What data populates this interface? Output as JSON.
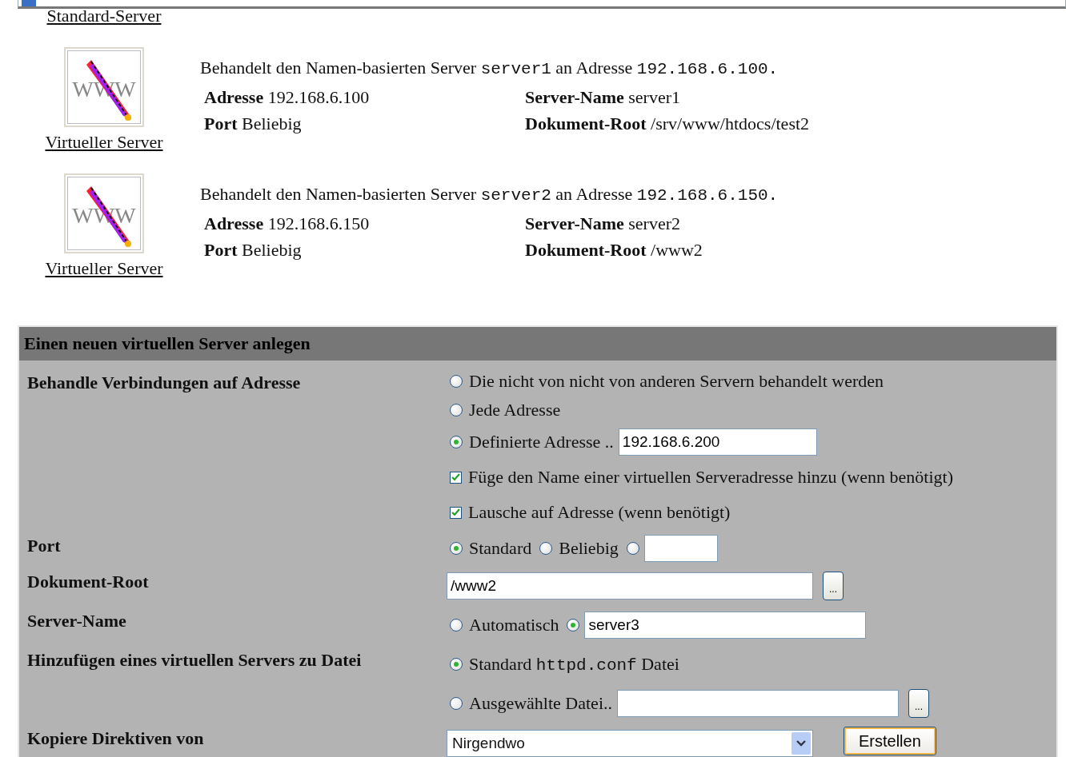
{
  "standard_server_link": "Standard-Server",
  "virtual_servers": [
    {
      "icon_text": "WWW",
      "link": "Virtueller Server",
      "description": [
        {
          "kind": "plain",
          "text": "Behandelt den Namen-basierten Server "
        },
        {
          "kind": "code",
          "text": "server1"
        },
        {
          "kind": "plain",
          "text": " an Adresse "
        },
        {
          "kind": "code",
          "text": "192.168.6.100."
        }
      ],
      "fields": [
        {
          "label": "Adresse",
          "value": "192.168.6.100"
        },
        {
          "label": "Server-Name",
          "value": "server1"
        },
        {
          "label": "Port",
          "value": "Beliebig"
        },
        {
          "label": "Dokument-Root",
          "value": "/srv/www/htdocs/test2"
        }
      ]
    },
    {
      "icon_text": "WWW",
      "link": "Virtueller Server",
      "description": [
        {
          "kind": "plain",
          "text": "Behandelt den Namen-basierten Server "
        },
        {
          "kind": "code",
          "text": "server2"
        },
        {
          "kind": "plain",
          "text": " an Adresse "
        },
        {
          "kind": "code",
          "text": "192.168.6.150."
        }
      ],
      "fields": [
        {
          "label": "Adresse",
          "value": "192.168.6.150"
        },
        {
          "label": "Server-Name",
          "value": "server2"
        },
        {
          "label": "Port",
          "value": "Beliebig"
        },
        {
          "label": "Dokument-Root",
          "value": "/www2"
        }
      ]
    }
  ],
  "form": {
    "title": "Einen neuen virtuellen Server anlegen",
    "rows": [
      {
        "label": "Behandle Verbindungen auf Adresse",
        "lines": [
          [
            {
              "kind": "radio",
              "selected": false,
              "label": "Die nicht von nicht von anderen Servern behandelt werden"
            }
          ],
          [
            {
              "kind": "radio",
              "selected": false,
              "label": "Jede Adresse"
            }
          ],
          [
            {
              "kind": "radio",
              "selected": true,
              "label": "Definierte Adresse .."
            },
            {
              "kind": "text",
              "value": "192.168.6.200"
            }
          ],
          [
            {
              "kind": "checkbox",
              "checked": true,
              "label": "Füge den Name einer virtuellen Serveradresse hinzu (wenn benötigt)"
            }
          ],
          [
            {
              "kind": "checkbox",
              "checked": true,
              "label": "Lausche auf Adresse (wenn benötigt)"
            }
          ]
        ]
      },
      {
        "label": "Port",
        "lines": [
          [
            {
              "kind": "radio",
              "selected": true,
              "label": "Standard"
            },
            {
              "kind": "radio",
              "selected": false,
              "label": "Beliebig"
            },
            {
              "kind": "radio",
              "selected": false
            },
            {
              "kind": "text"
            }
          ]
        ]
      },
      {
        "label": "Dokument-Root",
        "lines": [
          [
            {
              "kind": "text",
              "value": "/www2"
            },
            {
              "kind": "browse",
              "label": "..."
            }
          ]
        ]
      },
      {
        "label": "Server-Name",
        "lines": [
          [
            {
              "kind": "radio",
              "selected": false,
              "label": "Automatisch"
            },
            {
              "kind": "radio",
              "selected": true
            },
            {
              "kind": "text",
              "value": "server3"
            }
          ]
        ]
      },
      {
        "label": "Hinzufügen eines virtuellen Servers zu Datei",
        "lines": [
          [
            {
              "kind": "radio",
              "selected": true,
              "parts": [
                {
                  "kind": "plain",
                  "text": "Standard "
                },
                {
                  "kind": "code",
                  "text": "httpd.conf"
                },
                {
                  "kind": "plain",
                  "text": " Datei"
                }
              ]
            }
          ],
          [
            {
              "kind": "radio",
              "selected": false,
              "label": "Ausgewählte Datei.."
            },
            {
              "kind": "text"
            },
            {
              "kind": "browse",
              "label": "..."
            }
          ]
        ]
      },
      {
        "label": "Kopiere Direktiven von",
        "lines": [
          [
            {
              "kind": "select",
              "value": "Nirgendwo"
            },
            {
              "kind": "button",
              "label": "Erstellen"
            }
          ]
        ]
      }
    ]
  }
}
